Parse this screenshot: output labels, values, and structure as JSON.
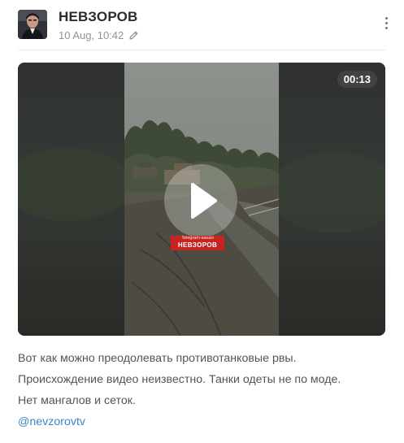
{
  "channel": {
    "name": "НЕВЗОРОВ",
    "date": "10 Aug, 10:42",
    "avatar_icon": "portrait-avatar",
    "edited_icon": "pencil-icon",
    "menu_icon": "more-vertical-icon"
  },
  "video": {
    "duration": "00:13",
    "play_icon": "play-icon",
    "watermark_top": "Telegram-канал",
    "watermark_main": "НЕВЗОРОВ",
    "watermark_color": "#c8241f"
  },
  "caption": {
    "lines": [
      "Вот как можно преодолевать противотанковые рвы.",
      "Происхождение видео неизвестно. Танки одеты не по моде.",
      "Нет мангалов и сеток."
    ],
    "link": "@nevzorovtv"
  },
  "colors": {
    "link": "#3a86c8",
    "text": "#50555a",
    "meta": "#8f9499"
  }
}
